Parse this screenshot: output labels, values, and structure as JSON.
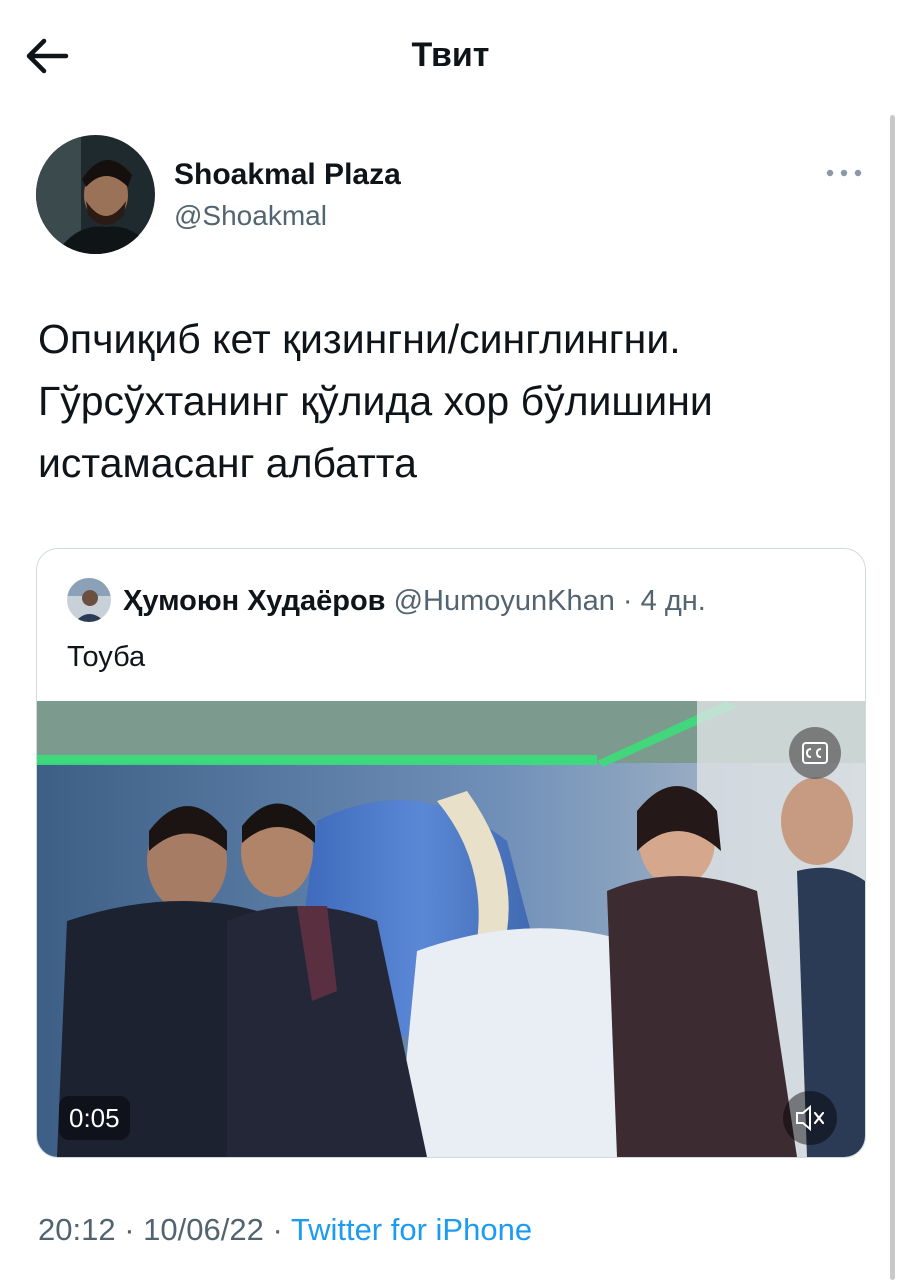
{
  "header": {
    "title": "Твит"
  },
  "author": {
    "name": "Shoakmal Plaza",
    "handle": "@Shoakmal"
  },
  "tweet": {
    "text": "Опчиқиб кет қизингни/синглингни.\nГўрсўхтанинг қўлида хор бўлишини\nистамасанг албатта"
  },
  "quoted_tweet": {
    "name": "Ҳумоюн Худаёров",
    "handle": "@HumoyunKhan",
    "separator": "·",
    "age": "4 дн.",
    "text": "Тоуба",
    "video": {
      "time": "0:05",
      "captions_icon": "closed-captions-icon",
      "mute_icon": "muted-speaker-icon"
    }
  },
  "meta": {
    "time": "20:12",
    "date": "10/06/22",
    "separator": "·",
    "source": "Twitter for iPhone"
  },
  "icons": {
    "back": "arrow-left-icon",
    "more": "more-horizontal-icon"
  },
  "colors": {
    "accent": "#1d9bf0",
    "secondary_text": "#536471",
    "primary_text": "#0f1419",
    "border": "#cfd9de"
  }
}
